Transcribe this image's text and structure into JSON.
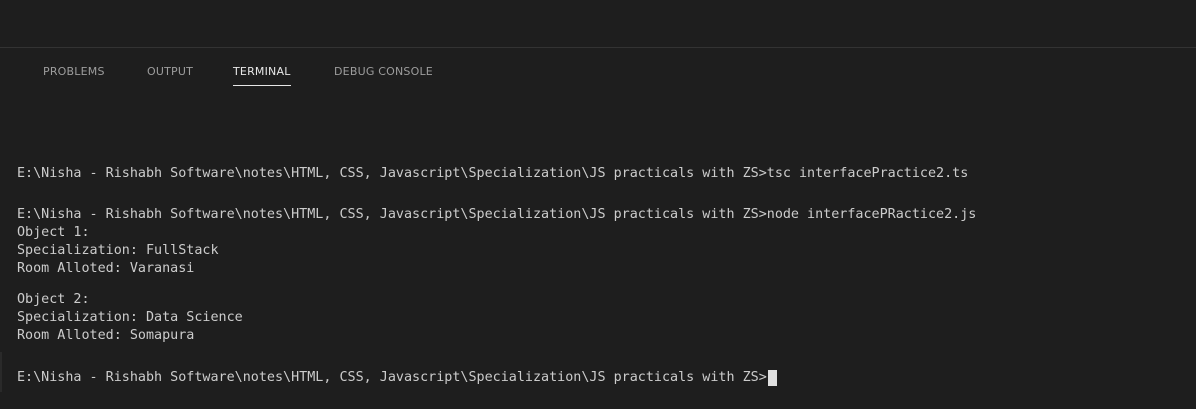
{
  "panel": {
    "tabs": [
      {
        "label": "PROBLEMS",
        "active": false
      },
      {
        "label": "OUTPUT",
        "active": false
      },
      {
        "label": "TERMINAL",
        "active": true
      },
      {
        "label": "DEBUG CONSOLE",
        "active": false
      }
    ]
  },
  "terminal": {
    "lines": [
      "E:\\Nisha - Rishabh Software\\notes\\HTML, CSS, Javascript\\Specialization\\JS practicals with ZS>tsc interfacePractice2.ts",
      "E:\\Nisha - Rishabh Software\\notes\\HTML, CSS, Javascript\\Specialization\\JS practicals with ZS>node interfacePRactice2.js",
      "Object 1:",
      "Specialization: FullStack",
      "Room Alloted: Varanasi",
      "Object 2:",
      "Specialization: Data Science",
      "Room Alloted: Somapura",
      "E:\\Nisha - Rishabh Software\\notes\\HTML, CSS, Javascript\\Specialization\\JS practicals with ZS>"
    ]
  },
  "colors": {
    "background": "#1e1e1e",
    "text": "#cccccc",
    "tab_inactive": "#9d9d9d",
    "tab_active": "#e7e7e7"
  }
}
